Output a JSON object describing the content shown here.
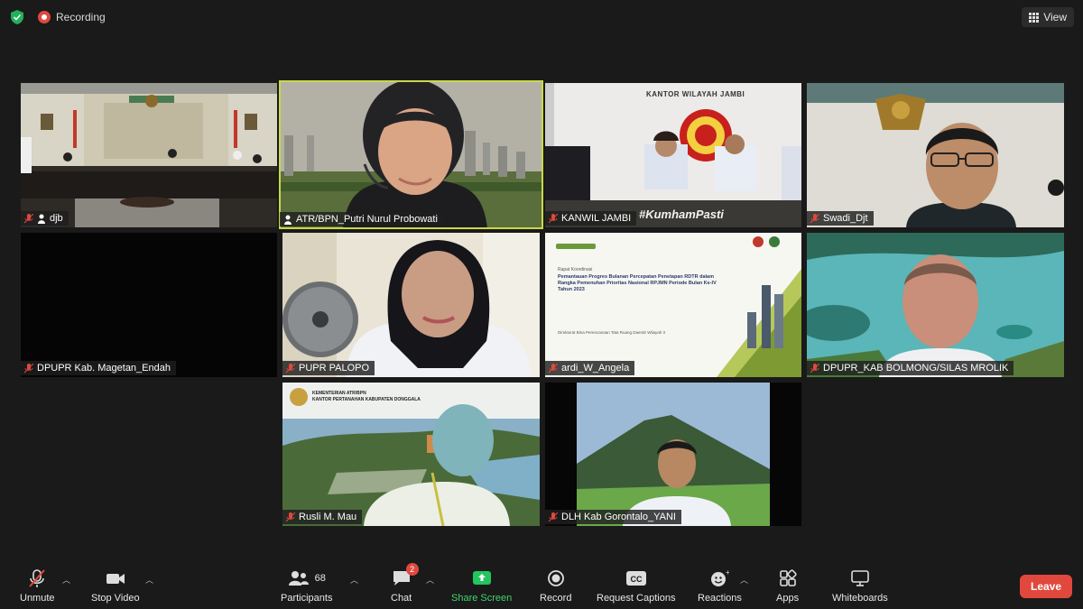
{
  "top_bar": {
    "recording_label": "Recording",
    "view_label": "View"
  },
  "participants": [
    {
      "name": "djb"
    },
    {
      "name": "ATR/BPN_Putri Nurul Probowati"
    },
    {
      "name": "KANWIL JAMBI",
      "banner_text": "KANTOR WILAYAH JAMBI",
      "overlay_text": "#KumhamPasti"
    },
    {
      "name": "Swadi_Djt"
    },
    {
      "name": "DPUPR Kab. Magetan_Endah"
    },
    {
      "name": "PUPR PALOPO"
    },
    {
      "name": "ardi_W_Angela",
      "slide": {
        "title": "Pemantauan Progres Bulanan Percepatan Penetapan RDTR dalam Rangka Pemenuhan Prioritas Nasional RPJMN Periode Bulan Ke-IV Tahun 2023",
        "kicker": "Rapat Koordinasi",
        "footer": "Direktorat Bina Perencanaan Tata Ruang Daerah Wilayah II"
      }
    },
    {
      "name": "DPUPR_KAB BOLMONG/SILAS MROLIK"
    },
    {
      "name": "Rusli M. Mau",
      "header_line1": "KEMENTERIAN ATR/BPN",
      "header_line2": "KANTOR PERTANAHAN KABUPATEN DONGGALA"
    },
    {
      "name": "DLH Kab Gorontalo_YANI"
    }
  ],
  "toolbar": {
    "unmute": "Unmute",
    "stop_video": "Stop Video",
    "participants": "Participants",
    "participants_count": "68",
    "chat": "Chat",
    "chat_badge": "2",
    "share_screen": "Share Screen",
    "record": "Record",
    "request_captions": "Request Captions",
    "reactions": "Reactions",
    "apps": "Apps",
    "whiteboards": "Whiteboards",
    "leave": "Leave"
  },
  "colors": {
    "background": "#1a1a1a",
    "active_speaker": "#c9d84a",
    "leave": "#e0483e",
    "share_green": "#23c55e"
  }
}
